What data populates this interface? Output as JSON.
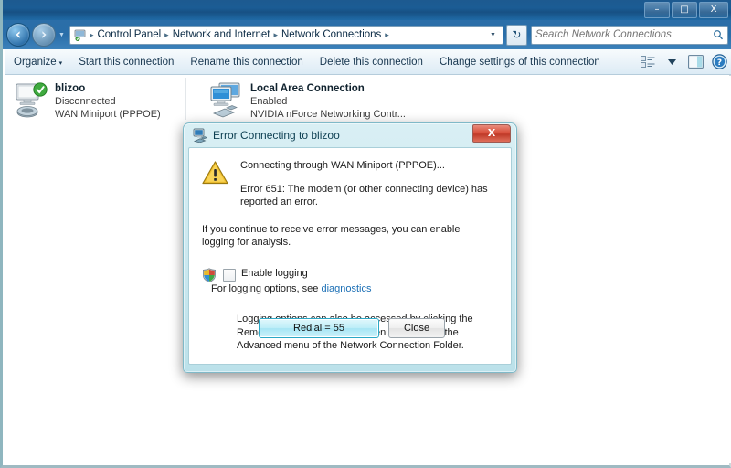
{
  "window": {
    "controls": {
      "minimize_label": "–",
      "maximize_label": "□",
      "close_label": "X"
    }
  },
  "addressbar": {
    "back_label": "⮜",
    "forward_label": "⮞",
    "history_caret": "▼",
    "breadcrumbs": [
      "Control Panel",
      "Network and Internet",
      "Network Connections"
    ],
    "separator": "▸",
    "dropdown_caret": "▼",
    "refresh_label": "↻",
    "search": {
      "placeholder": "Search Network Connections",
      "value": "",
      "icon": "search-icon"
    }
  },
  "toolbar": {
    "items": [
      {
        "label": "Organize",
        "has_caret": true
      },
      {
        "label": "Start this connection",
        "has_caret": false
      },
      {
        "label": "Rename this connection",
        "has_caret": false
      },
      {
        "label": "Delete this connection",
        "has_caret": false
      },
      {
        "label": "Change settings of this connection",
        "has_caret": false
      }
    ],
    "caret": "▾",
    "icons": [
      "views-icon",
      "views-caret-icon",
      "preview-pane-icon",
      "help-icon"
    ]
  },
  "connections": [
    {
      "name": "blizoo",
      "status": "Disconnected",
      "device": "WAN Miniport (PPPOE)",
      "icon": "dialup-connection-icon",
      "badge": "check-badge-icon"
    },
    {
      "name": "Local Area Connection",
      "status": "Enabled",
      "device": "NVIDIA nForce Networking Contr...",
      "icon": "lan-connection-icon",
      "badge": ""
    }
  ],
  "dialog": {
    "title": "Error Connecting to blizoo",
    "title_icon": "network-connection-icon",
    "close_label": "X",
    "warning_icon": "warning-triangle-icon",
    "message_connecting": "Connecting through WAN Miniport (PPPOE)...",
    "message_error": "Error 651: The modem (or other connecting device) has reported an error.",
    "message_continue": "If you continue to receive error messages, you can enable logging for analysis.",
    "shield_icon": "uac-shield-icon",
    "enable_logging_label": "Enable logging",
    "enable_logging_checked": false,
    "logging_options_prefix": "For logging options, see ",
    "diagnostics_link": "diagnostics",
    "logging_note": "Logging options can also be accessed by clicking the Remote Access Preferences menu item under the Advanced menu of the Network Connection Folder.",
    "redial_label": "Redial = 55",
    "close_button_label": "Close"
  },
  "colors": {
    "titlebar_blue": "#1d5a90",
    "addressbar_blue": "#2b6ea8",
    "dialog_frame": "#cbe8ef",
    "accent_cyan": "#a6e5f4",
    "link_blue": "#1b6fb5",
    "close_red": "#d9503c",
    "warning_yellow": "#f2c230"
  }
}
